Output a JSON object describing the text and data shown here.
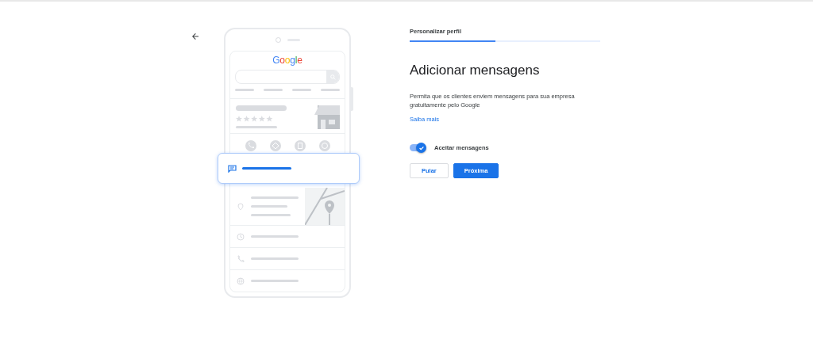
{
  "illustration": {
    "logo": "Google"
  },
  "progress": {
    "label": "Personalizar perfil",
    "level": 0.45
  },
  "title": "Adicionar mensagens",
  "description": "Permita que os clientes enviem mensagens para sua empresa gratuitamente pelo Google",
  "link": "Saiba mais",
  "toggle": {
    "label": "Aceitar mensagens",
    "on": true
  },
  "buttons": [
    {
      "label": "Pular",
      "kind": "secondary"
    },
    {
      "label": "Próxima",
      "kind": "primary"
    }
  ]
}
